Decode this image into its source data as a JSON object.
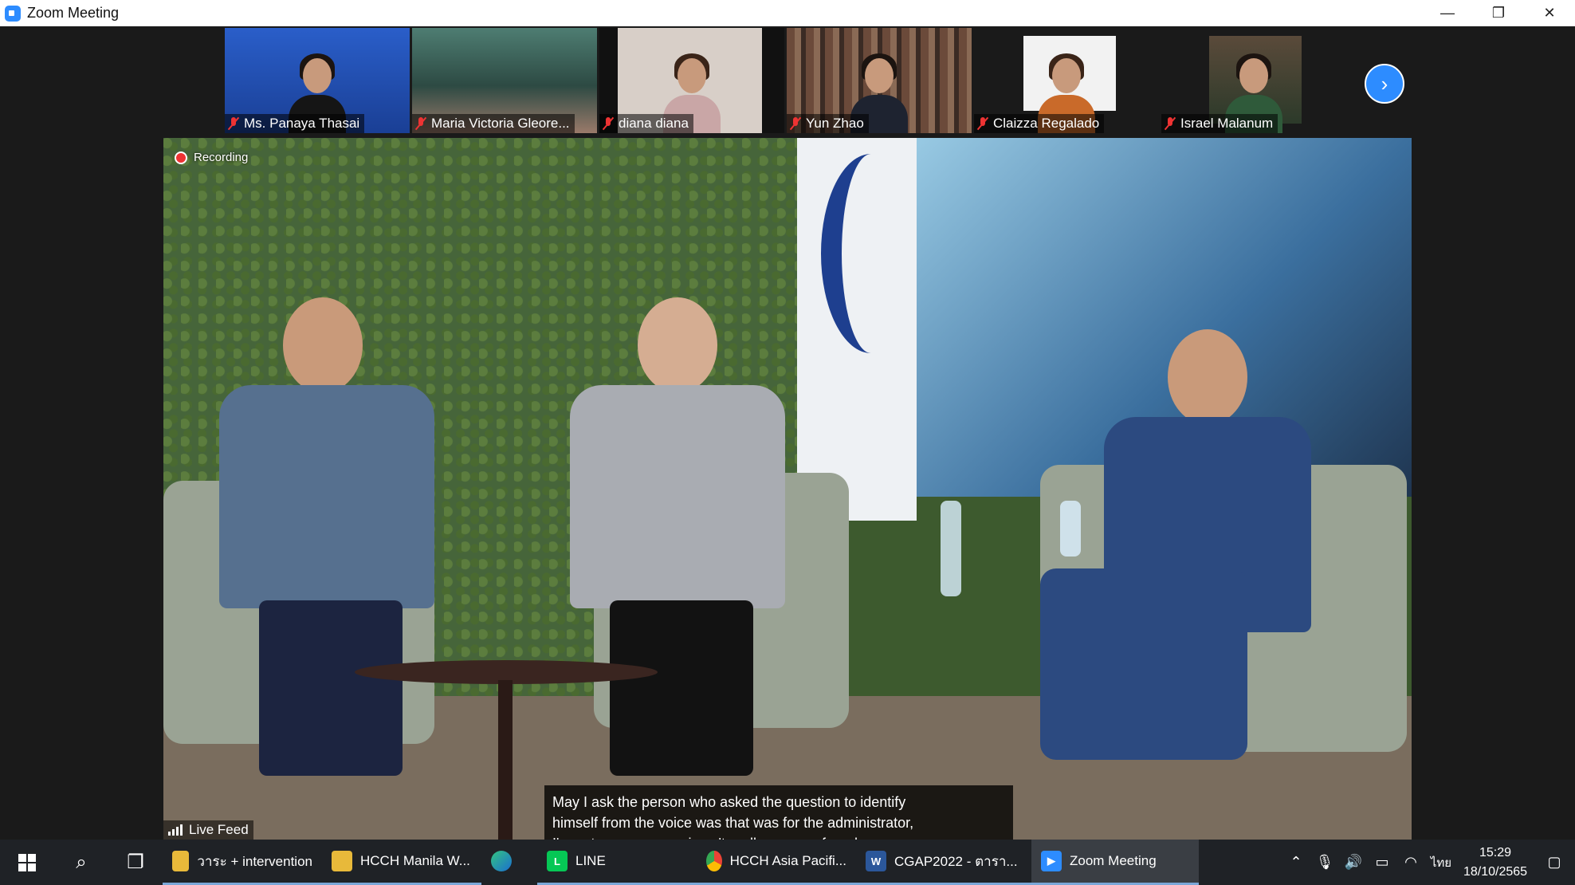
{
  "window": {
    "title": "Zoom Meeting",
    "minimize": "—",
    "restore": "❐",
    "close": "✕"
  },
  "gallery": {
    "participants": [
      {
        "name": "Ms. Panaya Thasai"
      },
      {
        "name": "Maria Victoria Gleore..."
      },
      {
        "name": "diana diana"
      },
      {
        "name": "Yun Zhao"
      },
      {
        "name": "Claizza Regalado"
      },
      {
        "name": "Israel Malanum"
      }
    ],
    "next_icon": "chevron-right-icon"
  },
  "video": {
    "recording_label": "Recording",
    "live_feed_label": "Live Feed",
    "caption_lines": [
      "May I ask the person who asked the question to identify",
      "himself from the voice was that was for the administrator,",
      "I'm not very sure cuz i can't really see you from here."
    ]
  },
  "taskbar": {
    "apps": [
      {
        "label": "วาระ + intervention",
        "icon": "folder-icon"
      },
      {
        "label": "HCCH Manila W...",
        "icon": "folder-icon"
      },
      {
        "label": "",
        "icon": "edge-icon"
      },
      {
        "label": "LINE",
        "icon": "line-icon"
      },
      {
        "label": "HCCH Asia Pacifi...",
        "icon": "chrome-icon"
      },
      {
        "label": "CGAP2022 - ตารา...",
        "icon": "word-icon"
      },
      {
        "label": "Zoom Meeting",
        "icon": "zoom-icon"
      }
    ],
    "tray": {
      "language": "ไทย",
      "time": "15:29",
      "date": "18/10/2565"
    }
  },
  "colors": {
    "accent": "#2d8cff",
    "taskbar": "#1f2226",
    "muted_mic": "#ee3333"
  }
}
